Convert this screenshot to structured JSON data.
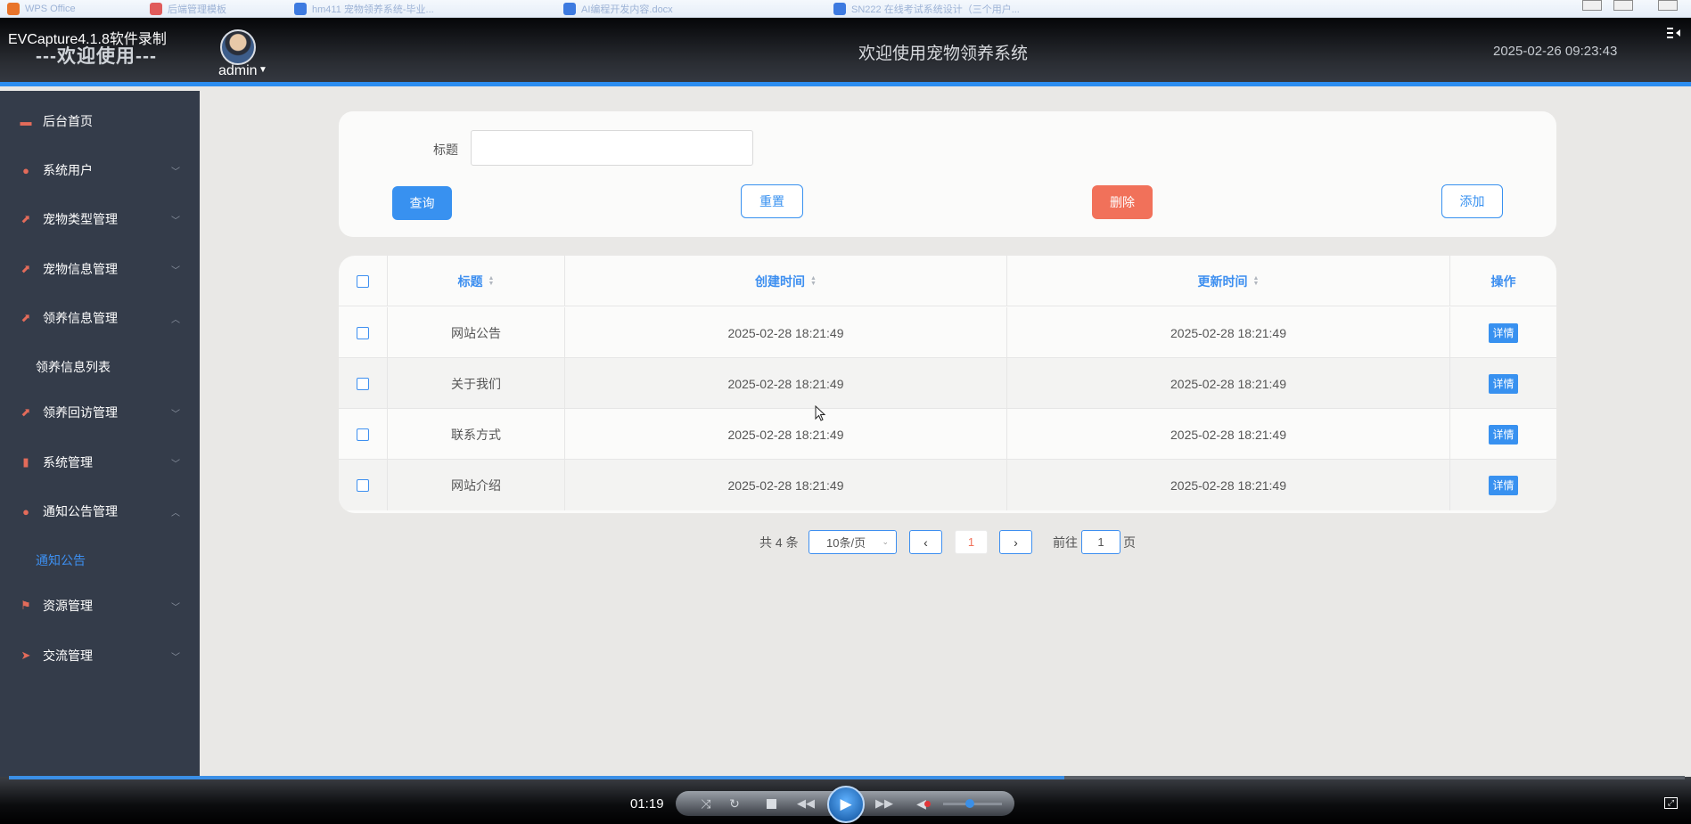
{
  "os_tabs": [
    {
      "label": "WPS Office",
      "color": "#e8742b"
    },
    {
      "label": "后端管理模板",
      "color": "#e05b5b"
    },
    {
      "label": "hm411 宠物领养系统-毕业...",
      "color": "#3d7ae0"
    },
    {
      "label": "AI编程开发内容.docx",
      "color": "#3d7ae0"
    },
    {
      "label": "SN222 在线考试系统设计（三个用户...",
      "color": "#3d7ae0"
    }
  ],
  "header": {
    "recorder_label": "EVCapture4.1.8软件录制",
    "welcome": "---欢迎使用---",
    "username": "admin",
    "system_title": "欢迎使用宠物领养系统",
    "datetime": "2025-02-26 09:23:43"
  },
  "sidebar": {
    "items": [
      {
        "label": "后台首页",
        "icon": "monitor-icon",
        "glyph": "▬",
        "expandable": false
      },
      {
        "label": "系统用户",
        "icon": "user-icon",
        "glyph": "●",
        "expandable": true,
        "expanded": false
      },
      {
        "label": "宠物类型管理",
        "icon": "chart-icon",
        "glyph": "⬈",
        "expandable": true,
        "expanded": false
      },
      {
        "label": "宠物信息管理",
        "icon": "chart-icon",
        "glyph": "⬈",
        "expandable": true,
        "expanded": false
      },
      {
        "label": "领养信息管理",
        "icon": "chart-icon",
        "glyph": "⬈",
        "expandable": true,
        "expanded": true
      },
      {
        "label": "领养信息列表",
        "sub": true
      },
      {
        "label": "领养回访管理",
        "icon": "chart-icon",
        "glyph": "⬈",
        "expandable": true,
        "expanded": false
      },
      {
        "label": "系统管理",
        "icon": "bar-chart-icon",
        "glyph": "▮",
        "expandable": true,
        "expanded": false
      },
      {
        "label": "通知公告管理",
        "icon": "info-icon",
        "glyph": "●",
        "expandable": true,
        "expanded": true
      },
      {
        "label": "通知公告",
        "sub": true,
        "active": true
      },
      {
        "label": "资源管理",
        "icon": "flag-icon",
        "glyph": "⚑",
        "expandable": true,
        "expanded": false
      },
      {
        "label": "交流管理",
        "icon": "send-icon",
        "glyph": "➤",
        "expandable": true,
        "expanded": false
      }
    ]
  },
  "search": {
    "label": "标题",
    "value": "",
    "placeholder": "",
    "query_label": "查询",
    "reset_label": "重置",
    "delete_label": "删除",
    "add_label": "添加"
  },
  "table": {
    "columns": [
      "标题",
      "创建时间",
      "更新时间",
      "操作"
    ],
    "rows": [
      {
        "title": "网站公告",
        "created": "2025-02-28 18:21:49",
        "updated": "2025-02-28 18:21:49",
        "action": "详情"
      },
      {
        "title": "关于我们",
        "created": "2025-02-28 18:21:49",
        "updated": "2025-02-28 18:21:49",
        "action": "详情"
      },
      {
        "title": "联系方式",
        "created": "2025-02-28 18:21:49",
        "updated": "2025-02-28 18:21:49",
        "action": "详情"
      },
      {
        "title": "网站介绍",
        "created": "2025-02-28 18:21:49",
        "updated": "2025-02-28 18:21:49",
        "action": "详情"
      }
    ]
  },
  "pagination": {
    "total_text": "共 4 条",
    "page_size": "10条/页",
    "current_page": "1",
    "goto_label": "前往",
    "goto_value": "1",
    "page_suffix": "页"
  },
  "player": {
    "time": "01:19",
    "progress": 0.63,
    "volume": 0.45
  },
  "colors": {
    "accent": "#3891f0",
    "danger": "#f1715a",
    "sidebar_bg": "#343c4a",
    "menu_icon": "#e36b5a"
  }
}
